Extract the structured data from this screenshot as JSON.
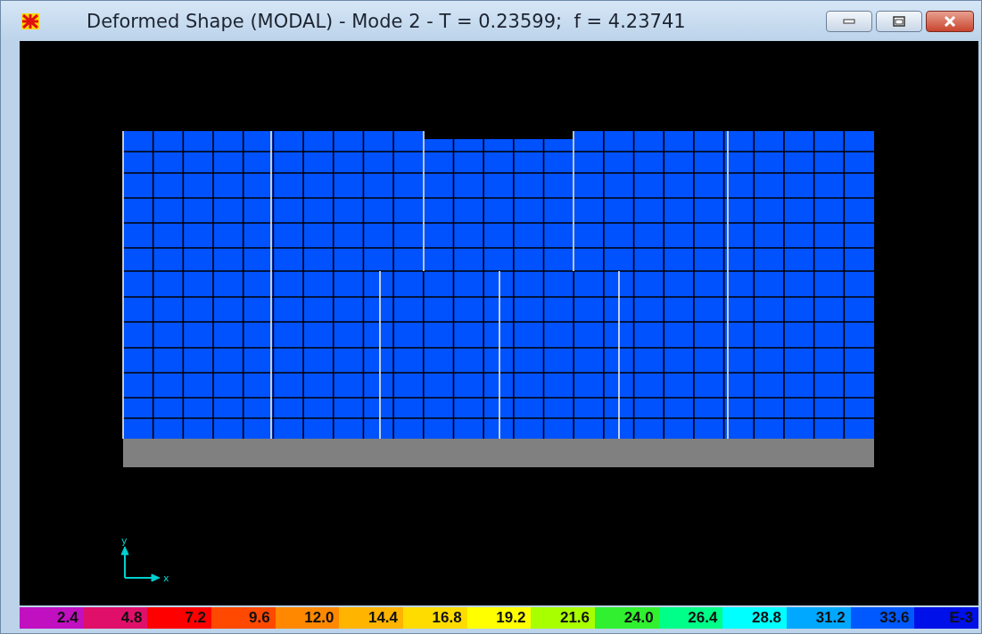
{
  "window": {
    "title": "Deformed Shape (MODAL) - Mode 2 - T = 0.23599;  f = 4.23741"
  },
  "axes": {
    "x_label": "x",
    "y_label": "y"
  },
  "legend": {
    "items": [
      {
        "label": "2.4",
        "color": "#c010c0"
      },
      {
        "label": "4.8",
        "color": "#e0106a"
      },
      {
        "label": "7.2",
        "color": "#ff0000"
      },
      {
        "label": "9.6",
        "color": "#ff4800"
      },
      {
        "label": "12.0",
        "color": "#ff8800"
      },
      {
        "label": "14.4",
        "color": "#ffb400"
      },
      {
        "label": "16.8",
        "color": "#ffdc00"
      },
      {
        "label": "19.2",
        "color": "#ffff00"
      },
      {
        "label": "21.6",
        "color": "#a8ff00"
      },
      {
        "label": "24.0",
        "color": "#30f030"
      },
      {
        "label": "26.4",
        "color": "#00ff88"
      },
      {
        "label": "28.8",
        "color": "#00ffff"
      },
      {
        "label": "31.2",
        "color": "#00a8ff"
      },
      {
        "label": "33.6",
        "color": "#0058ff"
      },
      {
        "label": "E-3",
        "color": "#0010e8"
      }
    ]
  }
}
